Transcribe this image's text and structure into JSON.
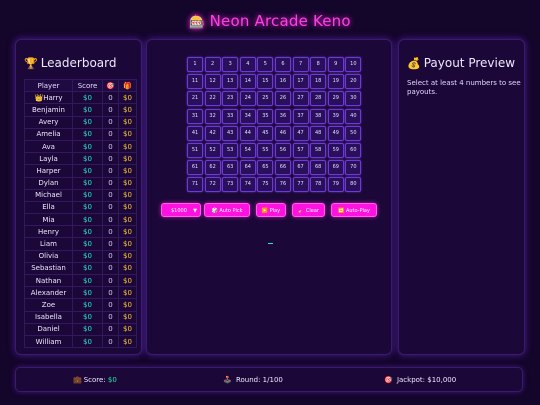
{
  "header": {
    "icon": "slot-machine-icon",
    "icon_glyph": "🎰",
    "title": "Neon Arcade Keno"
  },
  "leaderboard": {
    "icon": "trophy-icon",
    "icon_glyph": "🏆",
    "title": "Leaderboard",
    "columns": {
      "player": "Player",
      "score": "Score",
      "hits_icon": "🎯",
      "wins_icon": "🎁"
    },
    "crown_glyph": "👑",
    "rows": [
      {
        "player": "Harry",
        "score": "$0",
        "hits": "0",
        "win": "$0"
      },
      {
        "player": "Benjamin",
        "score": "$0",
        "hits": "0",
        "win": "$0"
      },
      {
        "player": "Avery",
        "score": "$0",
        "hits": "0",
        "win": "$0"
      },
      {
        "player": "Amelia",
        "score": "$0",
        "hits": "0",
        "win": "$0"
      },
      {
        "player": "Ava",
        "score": "$0",
        "hits": "0",
        "win": "$0"
      },
      {
        "player": "Layla",
        "score": "$0",
        "hits": "0",
        "win": "$0"
      },
      {
        "player": "Harper",
        "score": "$0",
        "hits": "0",
        "win": "$0"
      },
      {
        "player": "Dylan",
        "score": "$0",
        "hits": "0",
        "win": "$0"
      },
      {
        "player": "Michael",
        "score": "$0",
        "hits": "0",
        "win": "$0"
      },
      {
        "player": "Ella",
        "score": "$0",
        "hits": "0",
        "win": "$0"
      },
      {
        "player": "Mia",
        "score": "$0",
        "hits": "0",
        "win": "$0"
      },
      {
        "player": "Henry",
        "score": "$0",
        "hits": "0",
        "win": "$0"
      },
      {
        "player": "Liam",
        "score": "$0",
        "hits": "0",
        "win": "$0"
      },
      {
        "player": "Olivia",
        "score": "$0",
        "hits": "0",
        "win": "$0"
      },
      {
        "player": "Sebastian",
        "score": "$0",
        "hits": "0",
        "win": "$0"
      },
      {
        "player": "Nathan",
        "score": "$0",
        "hits": "0",
        "win": "$0"
      },
      {
        "player": "Alexander",
        "score": "$0",
        "hits": "0",
        "win": "$0"
      },
      {
        "player": "Zoe",
        "score": "$0",
        "hits": "0",
        "win": "$0"
      },
      {
        "player": "Isabella",
        "score": "$0",
        "hits": "0",
        "win": "$0"
      },
      {
        "player": "Daniel",
        "score": "$0",
        "hits": "0",
        "win": "$0"
      },
      {
        "player": "William",
        "score": "$0",
        "hits": "0",
        "win": "$0"
      }
    ]
  },
  "keno": {
    "numbers": [
      1,
      2,
      3,
      4,
      5,
      6,
      7,
      8,
      9,
      10,
      11,
      12,
      13,
      14,
      15,
      16,
      17,
      18,
      19,
      20,
      21,
      22,
      23,
      24,
      25,
      26,
      27,
      28,
      29,
      30,
      31,
      32,
      33,
      34,
      35,
      36,
      37,
      38,
      39,
      40,
      41,
      42,
      43,
      44,
      45,
      46,
      47,
      48,
      49,
      50,
      51,
      52,
      53,
      54,
      55,
      56,
      57,
      58,
      59,
      60,
      61,
      62,
      63,
      64,
      65,
      66,
      67,
      68,
      69,
      70,
      71,
      72,
      73,
      74,
      75,
      76,
      77,
      78,
      79,
      80
    ]
  },
  "controls": {
    "bet_value": "$1000",
    "autopick_icon": "🎲",
    "autopick_label": "Auto Pick",
    "play_icon": "▶️",
    "play_label": "Play",
    "clear_icon": "🧹",
    "clear_label": "Clear",
    "autoplay_icon": "🔁",
    "autoplay_label": "Auto-Play"
  },
  "payout": {
    "icon": "money-bag-icon",
    "icon_glyph": "💰",
    "title": "Payout Preview",
    "message": "Select at least 4 numbers to see payouts."
  },
  "footer": {
    "score_icon": "💼",
    "score_label": "Score: ",
    "score_value": "$0",
    "round_icon": "🕹️",
    "round_label": "Round: 1/100",
    "jackpot_icon": "🎯",
    "jackpot_label": "Jackpot: $10,000"
  },
  "colors": {
    "background": "#14052b",
    "accent_pink": "#ff12e0",
    "score_teal": "#22e5d2",
    "win_gold": "#ffc93a"
  }
}
